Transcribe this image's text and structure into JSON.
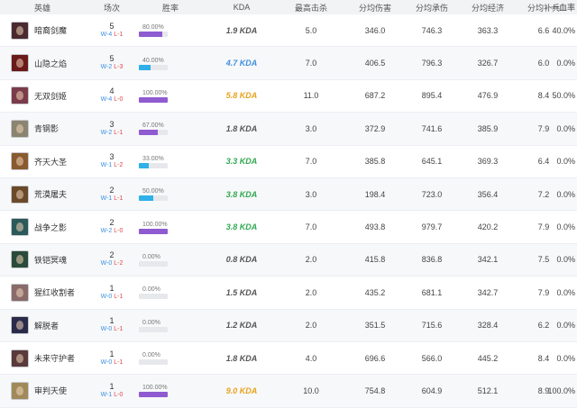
{
  "header": {
    "hero": "英雄",
    "games": "场次",
    "winrate": "胜率",
    "kda": "KDA",
    "max_kills": "最高击杀",
    "avg_damage": "分均伤害",
    "avg_taken": "分均承伤",
    "avg_gold": "分均经济",
    "avg_cs": "分均补兵",
    "first_blood": "一血率"
  },
  "colors": {
    "winrate_bar_purple": "#8e5bd0",
    "winrate_bar_blue": "#2fb0e8",
    "kda_gray": "#555555",
    "kda_blue": "#3d8fe0",
    "kda_gold": "#e8a21a",
    "kda_green": "#2fa84f",
    "wins": "#3d8fe0",
    "losses": "#e04a4a"
  },
  "rows": [
    {
      "hero": "暗裔剑魔",
      "avatar_color": "#4a2a2e",
      "games": "5",
      "wins": "W-4",
      "losses": "L-1",
      "winrate_text": "80.00%",
      "winrate": 80,
      "bar_color": "#8e5bd0",
      "kda": "1.9 KDA",
      "kda_color": "#555555",
      "max_kills": "5.0",
      "avg_damage": "346.0",
      "avg_taken": "746.3",
      "avg_gold": "363.3",
      "avg_cs": "6.6",
      "first_blood": "40.0%"
    },
    {
      "hero": "山隐之焰",
      "avatar_color": "#6a1a1a",
      "games": "5",
      "wins": "W-2",
      "losses": "L-3",
      "winrate_text": "40.00%",
      "winrate": 40,
      "bar_color": "#2fb0e8",
      "kda": "4.7 KDA",
      "kda_color": "#3d8fe0",
      "max_kills": "7.0",
      "avg_damage": "406.5",
      "avg_taken": "796.3",
      "avg_gold": "326.7",
      "avg_cs": "6.0",
      "first_blood": "0.0%"
    },
    {
      "hero": "无双剑姬",
      "avatar_color": "#7a3b4a",
      "games": "4",
      "wins": "W-4",
      "losses": "L-0",
      "winrate_text": "100.00%",
      "winrate": 100,
      "bar_color": "#8e5bd0",
      "kda": "5.8 KDA",
      "kda_color": "#e8a21a",
      "max_kills": "11.0",
      "avg_damage": "687.2",
      "avg_taken": "895.4",
      "avg_gold": "476.9",
      "avg_cs": "8.4",
      "first_blood": "50.0%"
    },
    {
      "hero": "青钢影",
      "avatar_color": "#8a8470",
      "games": "3",
      "wins": "W-2",
      "losses": "L-1",
      "winrate_text": "67.00%",
      "winrate": 67,
      "bar_color": "#8e5bd0",
      "kda": "1.8 KDA",
      "kda_color": "#555555",
      "max_kills": "3.0",
      "avg_damage": "372.9",
      "avg_taken": "741.6",
      "avg_gold": "385.9",
      "avg_cs": "7.9",
      "first_blood": "0.0%"
    },
    {
      "hero": "齐天大圣",
      "avatar_color": "#8a5a30",
      "games": "3",
      "wins": "W-1",
      "losses": "L-2",
      "winrate_text": "33.00%",
      "winrate": 33,
      "bar_color": "#2fb0e8",
      "kda": "3.3 KDA",
      "kda_color": "#2fa84f",
      "max_kills": "7.0",
      "avg_damage": "385.8",
      "avg_taken": "645.1",
      "avg_gold": "369.3",
      "avg_cs": "6.4",
      "first_blood": "0.0%"
    },
    {
      "hero": "荒漠屠夫",
      "avatar_color": "#6a4a2a",
      "games": "2",
      "wins": "W-1",
      "losses": "L-1",
      "winrate_text": "50.00%",
      "winrate": 50,
      "bar_color": "#2fb0e8",
      "kda": "3.8 KDA",
      "kda_color": "#2fa84f",
      "max_kills": "3.0",
      "avg_damage": "198.4",
      "avg_taken": "723.0",
      "avg_gold": "356.4",
      "avg_cs": "7.2",
      "first_blood": "0.0%"
    },
    {
      "hero": "战争之影",
      "avatar_color": "#2a5a5a",
      "games": "2",
      "wins": "W-2",
      "losses": "L-0",
      "winrate_text": "100.00%",
      "winrate": 100,
      "bar_color": "#8e5bd0",
      "kda": "3.8 KDA",
      "kda_color": "#2fa84f",
      "max_kills": "7.0",
      "avg_damage": "493.8",
      "avg_taken": "979.7",
      "avg_gold": "420.2",
      "avg_cs": "7.9",
      "first_blood": "0.0%"
    },
    {
      "hero": "铁铠冥魂",
      "avatar_color": "#2a4a3a",
      "games": "2",
      "wins": "W-0",
      "losses": "L-2",
      "winrate_text": "0.00%",
      "winrate": 0,
      "bar_color": "#2fb0e8",
      "kda": "0.8 KDA",
      "kda_color": "#555555",
      "max_kills": "2.0",
      "avg_damage": "415.8",
      "avg_taken": "836.8",
      "avg_gold": "342.1",
      "avg_cs": "7.5",
      "first_blood": "0.0%"
    },
    {
      "hero": "猩红收割者",
      "avatar_color": "#8a6a6a",
      "games": "1",
      "wins": "W-0",
      "losses": "L-1",
      "winrate_text": "0.00%",
      "winrate": 0,
      "bar_color": "#2fb0e8",
      "kda": "1.5 KDA",
      "kda_color": "#555555",
      "max_kills": "2.0",
      "avg_damage": "435.2",
      "avg_taken": "681.1",
      "avg_gold": "342.7",
      "avg_cs": "7.9",
      "first_blood": "0.0%"
    },
    {
      "hero": "解脱者",
      "avatar_color": "#2a2a4a",
      "games": "1",
      "wins": "W-0",
      "losses": "L-1",
      "winrate_text": "0.00%",
      "winrate": 0,
      "bar_color": "#2fb0e8",
      "kda": "1.2 KDA",
      "kda_color": "#555555",
      "max_kills": "2.0",
      "avg_damage": "351.5",
      "avg_taken": "715.6",
      "avg_gold": "328.4",
      "avg_cs": "6.2",
      "first_blood": "0.0%"
    },
    {
      "hero": "未来守护者",
      "avatar_color": "#5a3a3a",
      "games": "1",
      "wins": "W-0",
      "losses": "L-1",
      "winrate_text": "0.00%",
      "winrate": 0,
      "bar_color": "#2fb0e8",
      "kda": "1.8 KDA",
      "kda_color": "#555555",
      "max_kills": "4.0",
      "avg_damage": "696.6",
      "avg_taken": "566.0",
      "avg_gold": "445.2",
      "avg_cs": "8.4",
      "first_blood": "0.0%"
    },
    {
      "hero": "审判天使",
      "avatar_color": "#a08a5a",
      "games": "1",
      "wins": "W-1",
      "losses": "L-0",
      "winrate_text": "100.00%",
      "winrate": 100,
      "bar_color": "#8e5bd0",
      "kda": "9.0 KDA",
      "kda_color": "#e8a21a",
      "max_kills": "10.0",
      "avg_damage": "754.8",
      "avg_taken": "604.9",
      "avg_gold": "512.1",
      "avg_cs": "8.9",
      "first_blood": "100.0%"
    }
  ]
}
